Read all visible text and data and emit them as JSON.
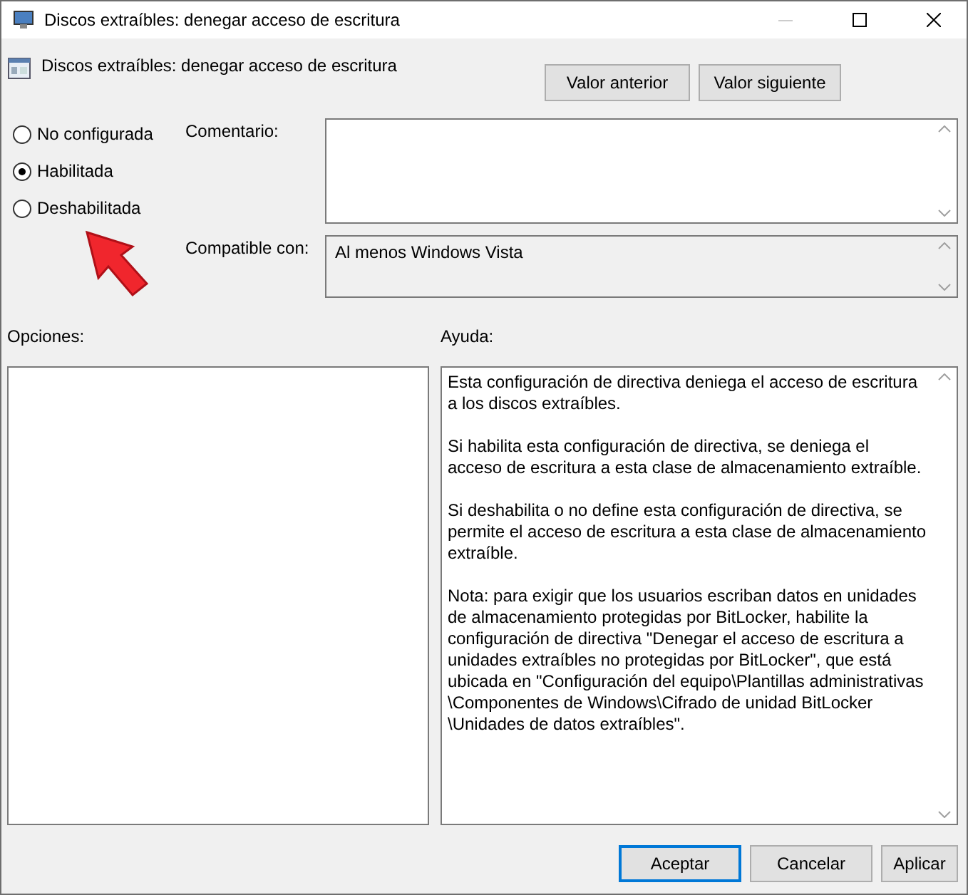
{
  "window": {
    "title": "Discos extraíbles: denegar acceso de escritura"
  },
  "header": {
    "title": "Discos extraíbles: denegar acceso de escritura",
    "buttons": [
      "Valor anterior",
      "Valor siguiente"
    ]
  },
  "options": [
    {
      "label": "No configurada",
      "selected": false
    },
    {
      "label": "Habilitada",
      "selected": true
    },
    {
      "label": "Deshabilitada",
      "selected": false
    }
  ],
  "comment": {
    "label": "Comentario:"
  },
  "compatible": {
    "label": "Compatible con:",
    "value": "Al menos Windows Vista"
  },
  "options_label": "Opciones:",
  "help": {
    "label": "Ayuda:",
    "paragraphs": [
      "Esta configuración de directiva deniega el acceso de escritura a los discos extraíbles.",
      "Si habilita esta configuración de directiva, se deniega el acceso de escritura a esta clase de almacenamiento extraíble.",
      "Si deshabilita o no define esta configuración de directiva, se permite el acceso de escritura a esta clase de almacenamiento extraíble.",
      "Nota: para exigir que los usuarios escriban datos en unidades de almacenamiento protegidas por BitLocker, habilite la configuración de directiva \"Denegar el acceso de escritura a unidades extraíbles no protegidas por BitLocker\", que está ubicada en \"Configuración del equipo\\Plantillas administrativas \\Componentes de Windows\\Cifrado de unidad BitLocker \\Unidades de datos extraíbles\"."
    ]
  },
  "footer": {
    "buttons": [
      {
        "label": "Aceptar",
        "selected": true
      },
      {
        "label": "Cancelar",
        "selected": false
      },
      {
        "label": "Aplicar",
        "selected": false
      }
    ]
  }
}
